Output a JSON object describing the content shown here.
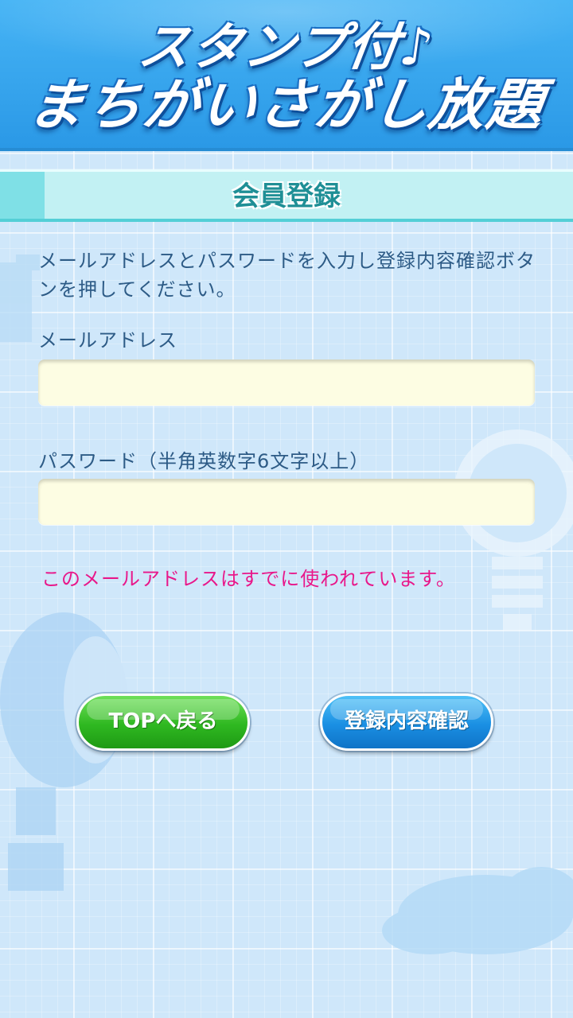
{
  "header": {
    "logo_line1": "スタンプ付♪",
    "logo_line2": "まちがいさがし放題"
  },
  "section": {
    "title": "会員登録"
  },
  "form": {
    "instruction": "メールアドレスとパスワードを入力し登録内容確認ボタンを押してください。",
    "email_label": "メールアドレス",
    "email_value": "",
    "password_label": "パスワード（半角英数字6文字以上）",
    "password_value": "",
    "error_message": "このメールアドレスはすでに使われています。"
  },
  "buttons": {
    "top_label": "TOPへ戻る",
    "confirm_label": "登録内容確認"
  },
  "colors": {
    "header_blue": "#2a98e6",
    "title_bar": "#c2f1f3",
    "error_pink": "#e8178a",
    "button_green": "#2fb821",
    "button_blue": "#1a8fe3",
    "input_bg": "#fdfde3"
  }
}
